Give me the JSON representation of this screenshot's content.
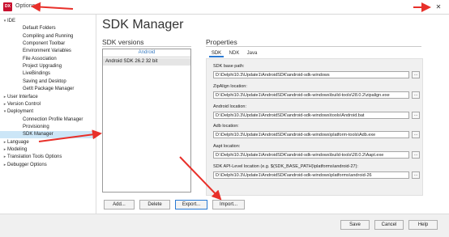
{
  "window": {
    "title": "Options",
    "app_icon_text": "DX",
    "close_glyph": "✕"
  },
  "tree": {
    "items": [
      {
        "label": "IDE",
        "indent": 0,
        "expander": "▾",
        "selected": false
      },
      {
        "label": "Default Folders",
        "indent": 2,
        "expander": "",
        "selected": false
      },
      {
        "label": "Compiling and Running",
        "indent": 2,
        "expander": "",
        "selected": false
      },
      {
        "label": "Component Toolbar",
        "indent": 2,
        "expander": "",
        "selected": false
      },
      {
        "label": "Environment Variables",
        "indent": 2,
        "expander": "",
        "selected": false
      },
      {
        "label": "File Association",
        "indent": 2,
        "expander": "",
        "selected": false
      },
      {
        "label": "Project Upgrading",
        "indent": 2,
        "expander": "",
        "selected": false
      },
      {
        "label": "LiveBindings",
        "indent": 2,
        "expander": "",
        "selected": false
      },
      {
        "label": "Saving and Desktop",
        "indent": 2,
        "expander": "",
        "selected": false
      },
      {
        "label": "GetIt Package Manager",
        "indent": 2,
        "expander": "",
        "selected": false
      },
      {
        "label": "User Interface",
        "indent": 0,
        "expander": "▸",
        "selected": false
      },
      {
        "label": "Version Control",
        "indent": 0,
        "expander": "▸",
        "selected": false
      },
      {
        "label": "Deployment",
        "indent": 0,
        "expander": "▾",
        "selected": false
      },
      {
        "label": "Connection Profile Manager",
        "indent": 2,
        "expander": "",
        "selected": false
      },
      {
        "label": "Provisioning",
        "indent": 2,
        "expander": "",
        "selected": false
      },
      {
        "label": "SDK Manager",
        "indent": 2,
        "expander": "",
        "selected": true
      },
      {
        "label": "Language",
        "indent": 0,
        "expander": "▸",
        "selected": false
      },
      {
        "label": "Modeling",
        "indent": 0,
        "expander": "▸",
        "selected": false
      },
      {
        "label": "Translation Tools Options",
        "indent": 0,
        "expander": "▸",
        "selected": false
      },
      {
        "label": "Debugger Options",
        "indent": 0,
        "expander": "▸",
        "selected": false
      }
    ]
  },
  "main": {
    "title": "SDK Manager",
    "sdk_versions": {
      "heading": "SDK versions",
      "list_header": "Android",
      "items": [
        "Android SDK 26.2 32 bit"
      ]
    },
    "properties": {
      "heading": "Properties",
      "tabs": [
        "SDK",
        "NDK",
        "Java"
      ],
      "active_tab": "SDK",
      "fields": [
        {
          "label": "SDK base path:",
          "value": "D:\\Delphi10.3\\Update1\\AndroidSDK\\android-sdk-windows"
        },
        {
          "label": "ZipAlign location:",
          "value": "D:\\Delphi10.3\\Update1\\AndroidSDK\\android-sdk-windows\\build-tools\\28.0.2\\zipalign.exe"
        },
        {
          "label": "Android location:",
          "value": "D:\\Delphi10.3\\Update1\\AndroidSDK\\android-sdk-windows\\tools\\Android.bat"
        },
        {
          "label": "Adb location:",
          "value": "D:\\Delphi10.3\\Update1\\AndroidSDK\\android-sdk-windows\\platform-tools\\Adb.exe"
        },
        {
          "label": "Aapt location:",
          "value": "D:\\Delphi10.3\\Update1\\AndroidSDK\\android-sdk-windows\\build-tools\\28.0.2\\Aapt.exe"
        },
        {
          "label": "SDK API-Level location (e.g. $(SDK_BASE_PATH)\\platforms\\android-27):",
          "value": "D:\\Delphi10.3\\Update1\\AndroidSDK\\android-sdk-windows\\platforms\\android-26"
        }
      ],
      "browse_label": "..."
    },
    "buttons": {
      "add": "Add...",
      "delete": "Delete",
      "export": "Export...",
      "import": "Import..."
    }
  },
  "footer": {
    "save": "Save",
    "cancel": "Cancel",
    "help": "Help"
  },
  "colors": {
    "accent": "#2a7ad3",
    "selection": "#cce6f7",
    "annotation_arrow": "#e8302a",
    "brand": "#c8102e"
  }
}
